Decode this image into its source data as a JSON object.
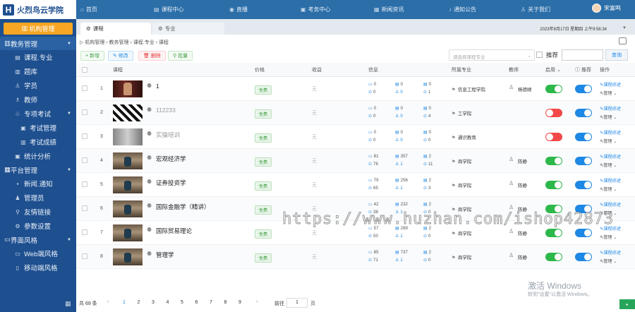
{
  "app": {
    "logo_mark": "H",
    "name": "火烈鸟云学院"
  },
  "nav": [
    {
      "icon": "home-icon",
      "glyph": "⌂",
      "label": "首页"
    },
    {
      "icon": "course-center-icon",
      "glyph": "▤",
      "label": "课程中心"
    },
    {
      "icon": "live-icon",
      "glyph": "◉",
      "label": "直播"
    },
    {
      "icon": "exam-center-icon",
      "glyph": "▣",
      "label": "考务中心"
    },
    {
      "icon": "news-icon",
      "glyph": "▦",
      "label": "新闻资讯"
    },
    {
      "icon": "notice-icon",
      "glyph": "♪",
      "label": "通知公告"
    },
    {
      "icon": "about-icon",
      "glyph": "♙",
      "label": "关于我们"
    }
  ],
  "user": {
    "name": "宋富鸣"
  },
  "sidebar": {
    "top_button": "机构管理",
    "groups": [
      {
        "label": "教务管理",
        "items": [
          {
            "label": "课程.专业",
            "icon": "▤"
          },
          {
            "label": "题库",
            "icon": "▥"
          },
          {
            "label": "学员",
            "icon": "♙"
          },
          {
            "label": "教师",
            "icon": "♗"
          },
          {
            "label": "专项考试",
            "icon": "♧",
            "expand": true
          },
          {
            "label": "考试管理",
            "icon": "▣",
            "sub": true
          },
          {
            "label": "考试成绩",
            "icon": "▥",
            "sub": true
          },
          {
            "label": "统计分析",
            "icon": "▣"
          }
        ]
      },
      {
        "label": "平台管理",
        "items": [
          {
            "label": "新闻.通知",
            "icon": "▪"
          },
          {
            "label": "管理员",
            "icon": "♟"
          },
          {
            "label": "友情链接",
            "icon": "⚲"
          },
          {
            "label": "参数设置",
            "icon": "⚙"
          }
        ]
      },
      {
        "label": "界面风格",
        "items": [
          {
            "label": "Web端风格",
            "icon": "▭"
          },
          {
            "label": "移动端风格",
            "icon": "▯"
          }
        ]
      }
    ]
  },
  "tabs": [
    {
      "label": "课程"
    },
    {
      "label": "专业"
    }
  ],
  "datetime": "2023年8月17日 星期四 上午9:56:34",
  "breadcrumb": "机构管理 › 教务管理 › 课程.专业 › 课程",
  "toolbar": {
    "add": "+ 新增",
    "edit": "✎ 修改",
    "del": "🗑 删除",
    "batch": "⚲ 批量"
  },
  "filter": {
    "subject_placeholder": "请选择课程专业",
    "recommend_label": "推荐",
    "search": "查询"
  },
  "headers": {
    "course": "课程",
    "price": "价格",
    "income": "收益",
    "info": "信息",
    "major": "所属专业",
    "teacher": "教师",
    "enable": "启用",
    "recommend": "推荐",
    "action": "操作"
  },
  "courses": [
    {
      "no": "1",
      "name": "1",
      "price": "免费",
      "income": "无",
      "video": "0",
      "doc": "0",
      "q": "0",
      "view": "0",
      "stu": "0",
      "play": "1",
      "major": "信息工程学院",
      "teacher": "杨德顺",
      "enabled": true,
      "recommend": true,
      "thumb": "red",
      "gray": false
    },
    {
      "no": "2",
      "name": "112233",
      "price": "免费",
      "income": "无",
      "video": "0",
      "doc": "0",
      "q": "0",
      "view": "0",
      "stu": "0",
      "play": "4",
      "major": "工学院",
      "teacher": "",
      "enabled": false,
      "recommend": true,
      "thumb": "bw",
      "gray": true
    },
    {
      "no": "3",
      "name": "实操培训",
      "price": "免费",
      "income": "无",
      "video": "0",
      "doc": "0",
      "q": "0",
      "view": "0",
      "stu": "0",
      "play": "0",
      "major": "通识教育",
      "teacher": "",
      "enabled": false,
      "recommend": true,
      "thumb": "gray",
      "gray": true
    },
    {
      "no": "4",
      "name": "宏观经济学",
      "price": "免费",
      "income": "无",
      "video": "81",
      "doc": "357",
      "q": "2",
      "view": "76",
      "stu": "1",
      "play": "11",
      "major": "商学院",
      "teacher": "陈静",
      "enabled": true,
      "recommend": true,
      "thumb": "class",
      "gray": false
    },
    {
      "no": "5",
      "name": "证券投资学",
      "price": "免费",
      "income": "无",
      "video": "79",
      "doc": "256",
      "q": "2",
      "view": "65",
      "stu": "1",
      "play": "3",
      "major": "商学院",
      "teacher": "陈静",
      "enabled": true,
      "recommend": true,
      "thumb": "class",
      "gray": false
    },
    {
      "no": "6",
      "name": "国际金融学（精讲）",
      "price": "免费",
      "income": "无",
      "video": "42",
      "doc": "232",
      "q": "2",
      "view": "38",
      "stu": "1",
      "play": "0",
      "major": "商学院",
      "teacher": "陈静",
      "enabled": true,
      "recommend": true,
      "thumb": "class",
      "gray": false
    },
    {
      "no": "7",
      "name": "国际贸易理论",
      "price": "免费",
      "income": "无",
      "video": "57",
      "doc": "289",
      "q": "2",
      "view": "50",
      "stu": "1",
      "play": "0",
      "major": "商学院",
      "teacher": "陈静",
      "enabled": true,
      "recommend": true,
      "thumb": "class",
      "gray": false
    },
    {
      "no": "8",
      "name": "管理学",
      "price": "免费",
      "income": "无",
      "video": "85",
      "doc": "737",
      "q": "2",
      "view": "71",
      "stu": "1",
      "play": "0",
      "major": "商学院",
      "teacher": "陈静",
      "enabled": true,
      "recommend": true,
      "thumb": "class",
      "gray": false
    }
  ],
  "actions": {
    "outline": "课程综述",
    "manage": "管理"
  },
  "pager": {
    "total": "共 69 条",
    "pages": [
      "1",
      "2",
      "3",
      "4",
      "5",
      "6",
      "7",
      "8",
      "9"
    ],
    "goto": "前往",
    "goto_value": "1",
    "page_unit": "页"
  },
  "watermark": "https://www.huzhan.com/ishop42873",
  "os": {
    "activate": "激活 Windows",
    "activate_hint": "转到\"设置\"以激活 Windows。"
  },
  "colors": {
    "primary": "#1e4f8f",
    "accent": "#f6a623",
    "green": "#2db84b",
    "blue": "#1e88e5",
    "red": "#f24848"
  }
}
